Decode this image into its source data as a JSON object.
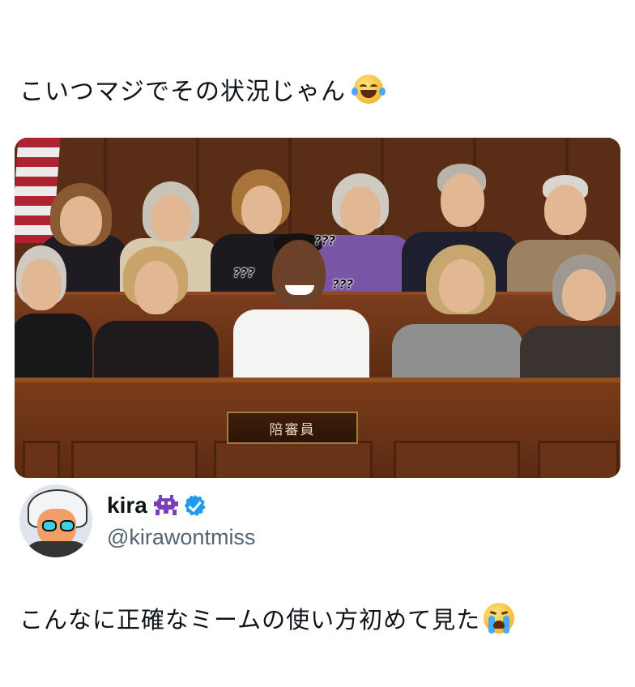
{
  "post": {
    "caption": "こいつマジでその状況じゃん",
    "caption_emoji": "face-with-tears-of-joy",
    "image": {
      "plaque_text": "陪審員",
      "question_marks": [
        "???",
        "???",
        "???"
      ]
    },
    "author": {
      "name": "kira",
      "name_emoji": "alien-monster",
      "verified": true,
      "handle": "@kirawontmiss"
    },
    "body_text": "こんなに正確なミームの使い方初めて見た",
    "body_emoji": "loudly-crying-face"
  },
  "colors": {
    "handle_gray": "#536471",
    "verified_blue": "#1d9bf0",
    "text": "#0f1419"
  }
}
